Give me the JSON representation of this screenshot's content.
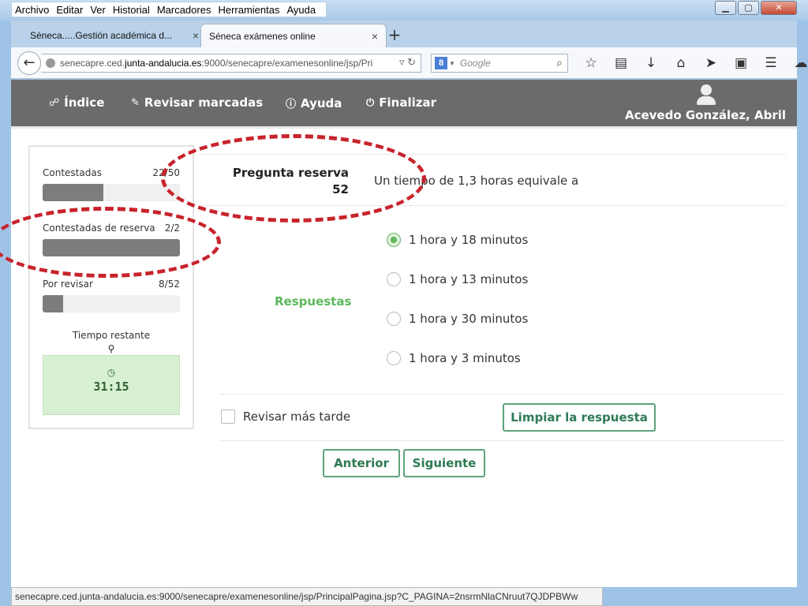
{
  "menu": [
    "Archivo",
    "Editar",
    "Ver",
    "Historial",
    "Marcadores",
    "Herramientas",
    "Ayuda"
  ],
  "window_controls": {
    "minimize": "▁",
    "maximize": "▢",
    "close": "✕"
  },
  "tabs": [
    {
      "label": "Séneca.....Gestión académica d...",
      "close": "×"
    },
    {
      "label": "Séneca exámenes online",
      "close": "×"
    }
  ],
  "new_tab": "+",
  "url": {
    "prefix": "senecapre.ced.",
    "domain": "junta-andalucia.es",
    "suffix": ":9000/senecapre/examenesonline/jsp/Pri"
  },
  "search": {
    "engine": "8",
    "placeholder": "Google"
  },
  "toolbar_icons": [
    "star-icon",
    "reading-list-icon",
    "download-icon",
    "home-icon",
    "send-icon",
    "screenshot-icon",
    "menu-icon",
    "cloud-icon"
  ],
  "app_nav": {
    "indice": "Índice",
    "revisar": "Revisar marcadas",
    "ayuda": "Ayuda",
    "finalizar": "Finalizar",
    "user_name": "Acevedo González, Abril"
  },
  "sidebar": {
    "contestadas": {
      "label": "Contestadas",
      "count": "22/50",
      "progress": 0.44
    },
    "reserva": {
      "label": "Contestadas de reserva",
      "count": "2/2",
      "progress": 1.0
    },
    "revisar": {
      "label": "Por revisar",
      "count": "8/52",
      "progress": 0.15
    },
    "timer_label": "Tiempo restante",
    "timer_value": "31:15"
  },
  "question": {
    "label": "Pregunta reserva",
    "number": "52",
    "text": "Un tiempo de 1,3 horas equivale a"
  },
  "answers_label": "Respuestas",
  "answers": [
    {
      "text": "1 hora y 18 minutos",
      "selected": true
    },
    {
      "text": "1 hora y 13 minutos",
      "selected": false
    },
    {
      "text": "1 hora y 30 minutos",
      "selected": false
    },
    {
      "text": "1 hora y 3 minutos",
      "selected": false
    }
  ],
  "review_later": "Revisar más tarde",
  "buttons": {
    "clear": "Limpiar la respuesta",
    "prev": "Anterior",
    "next": "Siguiente"
  },
  "status_url": "senecapre.ced.junta-andalucia.es:9000/senecapre/examenesonline/jsp/PrincipalPagina.jsp?C_PAGINA=2nsrmNlaCNruut7QJDPBWw",
  "colors": {
    "accent_green": "#5cb85c",
    "nav_bg": "#6b6b6b",
    "annotation_red": "#c8232c"
  }
}
